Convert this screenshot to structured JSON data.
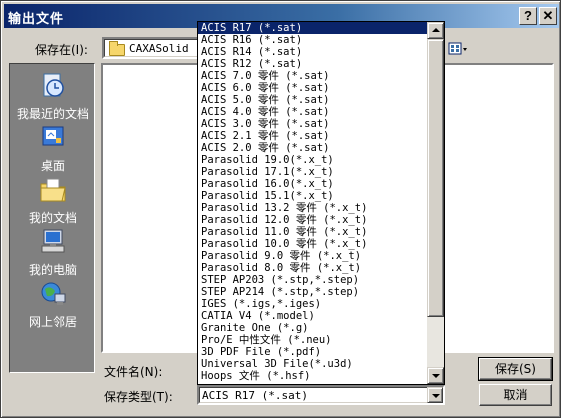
{
  "window": {
    "title": "输出文件",
    "help_label": "?",
    "close_label": "✕"
  },
  "save_in": {
    "label": "保存在(I):",
    "value": "CAXASolid"
  },
  "places": [
    {
      "label": "我最近的文档",
      "icon": "recent-documents-icon"
    },
    {
      "label": "桌面",
      "icon": "desktop-icon"
    },
    {
      "label": "我的文档",
      "icon": "my-documents-icon"
    },
    {
      "label": "我的电脑",
      "icon": "my-computer-icon"
    },
    {
      "label": "网上邻居",
      "icon": "network-places-icon"
    }
  ],
  "filename": {
    "label": "文件名(N):",
    "value": ""
  },
  "filetype": {
    "label": "保存类型(T):",
    "value": "ACIS R17 (*.sat)"
  },
  "buttons": {
    "save": "保存(S)",
    "cancel": "取消"
  },
  "filetype_options": [
    "ACIS R17 (*.sat)",
    "ACIS R16 (*.sat)",
    "ACIS R14 (*.sat)",
    "ACIS R12 (*.sat)",
    "ACIS 7.0 零件 (*.sat)",
    "ACIS 6.0 零件 (*.sat)",
    "ACIS 5.0 零件 (*.sat)",
    "ACIS 4.0 零件 (*.sat)",
    "ACIS 3.0 零件 (*.sat)",
    "ACIS 2.1 零件 (*.sat)",
    "ACIS 2.0 零件 (*.sat)",
    "Parasolid 19.0(*.x_t)",
    "Parasolid 17.1(*.x_t)",
    "Parasolid 16.0(*.x_t)",
    "Parasolid 15.1(*.x_t)",
    "Parasolid 13.2 零件 (*.x_t)",
    "Parasolid 12.0 零件 (*.x_t)",
    "Parasolid 11.0 零件 (*.x_t)",
    "Parasolid 10.0 零件 (*.x_t)",
    "Parasolid 9.0 零件 (*.x_t)",
    "Parasolid 8.0 零件 (*.x_t)",
    "STEP AP203 (*.stp,*.step)",
    "STEP AP214 (*.stp,*.step)",
    "IGES (*.igs,*.iges)",
    "CATIA V4 (*.model)",
    "Granite One (*.g)",
    "Pro/E 中性文件 (*.neu)",
    "3D PDF File (*.pdf)",
    "Universal 3D File(*.u3d)",
    "Hoops 文件 (*.hsf)"
  ],
  "selected_index": 0,
  "colors": {
    "title_bar": "#0a246a",
    "selection": "#0a246a",
    "face": "#d4d0c8"
  }
}
